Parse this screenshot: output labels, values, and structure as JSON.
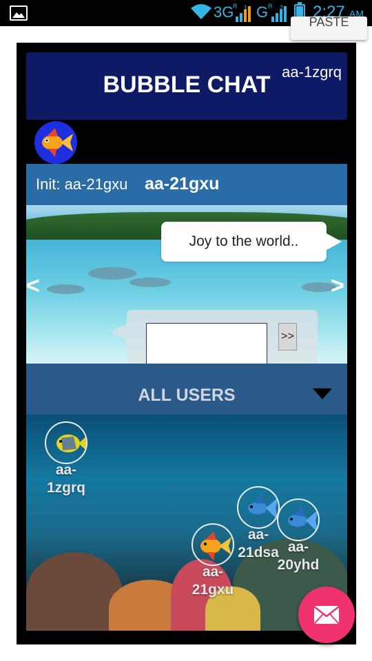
{
  "status_bar": {
    "network_1": "3G",
    "network_1_sup": "R",
    "network_1_sup2": "1",
    "network_2": "G",
    "network_2_sup": "R",
    "network_2_sup2": "2",
    "time": "2:27",
    "ampm": "AM",
    "icons": [
      "image-icon",
      "wifi-icon",
      "signal-icon",
      "battery-charging-icon"
    ]
  },
  "paste_popup": {
    "label": "PASTE"
  },
  "header": {
    "title": "BUBBLE CHAT",
    "user": "aa-1zgrq"
  },
  "init_bar": {
    "label": "Init: aa-21gxu",
    "name": "aa-21gxu"
  },
  "chat": {
    "message": "Joy to the world..",
    "prev": "<",
    "next": ">",
    "input_value": "",
    "send_label": ">>"
  },
  "users_panel": {
    "label": "ALL USERS"
  },
  "users": [
    {
      "name": "aa-\n1zgrq",
      "fish": "angelfish"
    },
    {
      "name": "aa-\n21dsa",
      "fish": "betta"
    },
    {
      "name": "aa-\n20yhd",
      "fish": "betta"
    },
    {
      "name": "aa-\n21gxu",
      "fish": "goldfish"
    }
  ],
  "fab": {
    "icon": "envelope-icon"
  },
  "colors": {
    "header_bg": "#0d1a66",
    "init_bar_bg": "#2a6ca8",
    "users_bar_bg": "#2a5a8a",
    "fab_bg": "#f0326f",
    "status_accent": "#33b5e5"
  }
}
